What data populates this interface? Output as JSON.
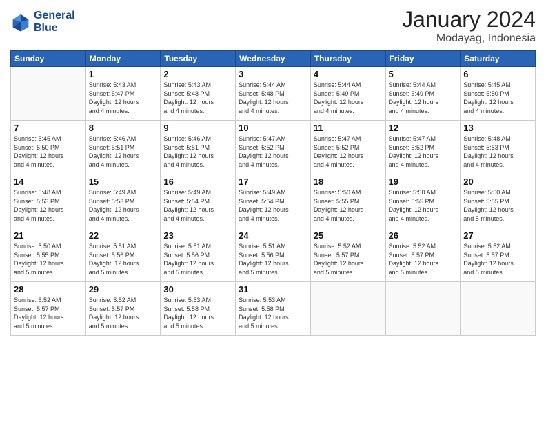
{
  "header": {
    "logo_line1": "General",
    "logo_line2": "Blue",
    "month_year": "January 2024",
    "location": "Modayag, Indonesia"
  },
  "days_of_week": [
    "Sunday",
    "Monday",
    "Tuesday",
    "Wednesday",
    "Thursday",
    "Friday",
    "Saturday"
  ],
  "weeks": [
    [
      {
        "day": "",
        "info": ""
      },
      {
        "day": "1",
        "info": "Sunrise: 5:43 AM\nSunset: 5:47 PM\nDaylight: 12 hours\nand 4 minutes."
      },
      {
        "day": "2",
        "info": "Sunrise: 5:43 AM\nSunset: 5:48 PM\nDaylight: 12 hours\nand 4 minutes."
      },
      {
        "day": "3",
        "info": "Sunrise: 5:44 AM\nSunset: 5:48 PM\nDaylight: 12 hours\nand 4 minutes."
      },
      {
        "day": "4",
        "info": "Sunrise: 5:44 AM\nSunset: 5:49 PM\nDaylight: 12 hours\nand 4 minutes."
      },
      {
        "day": "5",
        "info": "Sunrise: 5:44 AM\nSunset: 5:49 PM\nDaylight: 12 hours\nand 4 minutes."
      },
      {
        "day": "6",
        "info": "Sunrise: 5:45 AM\nSunset: 5:50 PM\nDaylight: 12 hours\nand 4 minutes."
      }
    ],
    [
      {
        "day": "7",
        "info": "Sunrise: 5:45 AM\nSunset: 5:50 PM\nDaylight: 12 hours\nand 4 minutes."
      },
      {
        "day": "8",
        "info": "Sunrise: 5:46 AM\nSunset: 5:51 PM\nDaylight: 12 hours\nand 4 minutes."
      },
      {
        "day": "9",
        "info": "Sunrise: 5:46 AM\nSunset: 5:51 PM\nDaylight: 12 hours\nand 4 minutes."
      },
      {
        "day": "10",
        "info": "Sunrise: 5:47 AM\nSunset: 5:52 PM\nDaylight: 12 hours\nand 4 minutes."
      },
      {
        "day": "11",
        "info": "Sunrise: 5:47 AM\nSunset: 5:52 PM\nDaylight: 12 hours\nand 4 minutes."
      },
      {
        "day": "12",
        "info": "Sunrise: 5:47 AM\nSunset: 5:52 PM\nDaylight: 12 hours\nand 4 minutes."
      },
      {
        "day": "13",
        "info": "Sunrise: 5:48 AM\nSunset: 5:53 PM\nDaylight: 12 hours\nand 4 minutes."
      }
    ],
    [
      {
        "day": "14",
        "info": "Sunrise: 5:48 AM\nSunset: 5:53 PM\nDaylight: 12 hours\nand 4 minutes."
      },
      {
        "day": "15",
        "info": "Sunrise: 5:49 AM\nSunset: 5:53 PM\nDaylight: 12 hours\nand 4 minutes."
      },
      {
        "day": "16",
        "info": "Sunrise: 5:49 AM\nSunset: 5:54 PM\nDaylight: 12 hours\nand 4 minutes."
      },
      {
        "day": "17",
        "info": "Sunrise: 5:49 AM\nSunset: 5:54 PM\nDaylight: 12 hours\nand 4 minutes."
      },
      {
        "day": "18",
        "info": "Sunrise: 5:50 AM\nSunset: 5:55 PM\nDaylight: 12 hours\nand 4 minutes."
      },
      {
        "day": "19",
        "info": "Sunrise: 5:50 AM\nSunset: 5:55 PM\nDaylight: 12 hours\nand 4 minutes."
      },
      {
        "day": "20",
        "info": "Sunrise: 5:50 AM\nSunset: 5:55 PM\nDaylight: 12 hours\nand 5 minutes."
      }
    ],
    [
      {
        "day": "21",
        "info": "Sunrise: 5:50 AM\nSunset: 5:55 PM\nDaylight: 12 hours\nand 5 minutes."
      },
      {
        "day": "22",
        "info": "Sunrise: 5:51 AM\nSunset: 5:56 PM\nDaylight: 12 hours\nand 5 minutes."
      },
      {
        "day": "23",
        "info": "Sunrise: 5:51 AM\nSunset: 5:56 PM\nDaylight: 12 hours\nand 5 minutes."
      },
      {
        "day": "24",
        "info": "Sunrise: 5:51 AM\nSunset: 5:56 PM\nDaylight: 12 hours\nand 5 minutes."
      },
      {
        "day": "25",
        "info": "Sunrise: 5:52 AM\nSunset: 5:57 PM\nDaylight: 12 hours\nand 5 minutes."
      },
      {
        "day": "26",
        "info": "Sunrise: 5:52 AM\nSunset: 5:57 PM\nDaylight: 12 hours\nand 5 minutes."
      },
      {
        "day": "27",
        "info": "Sunrise: 5:52 AM\nSunset: 5:57 PM\nDaylight: 12 hours\nand 5 minutes."
      }
    ],
    [
      {
        "day": "28",
        "info": "Sunrise: 5:52 AM\nSunset: 5:57 PM\nDaylight: 12 hours\nand 5 minutes."
      },
      {
        "day": "29",
        "info": "Sunrise: 5:52 AM\nSunset: 5:57 PM\nDaylight: 12 hours\nand 5 minutes."
      },
      {
        "day": "30",
        "info": "Sunrise: 5:53 AM\nSunset: 5:58 PM\nDaylight: 12 hours\nand 5 minutes."
      },
      {
        "day": "31",
        "info": "Sunrise: 5:53 AM\nSunset: 5:58 PM\nDaylight: 12 hours\nand 5 minutes."
      },
      {
        "day": "",
        "info": ""
      },
      {
        "day": "",
        "info": ""
      },
      {
        "day": "",
        "info": ""
      }
    ]
  ]
}
